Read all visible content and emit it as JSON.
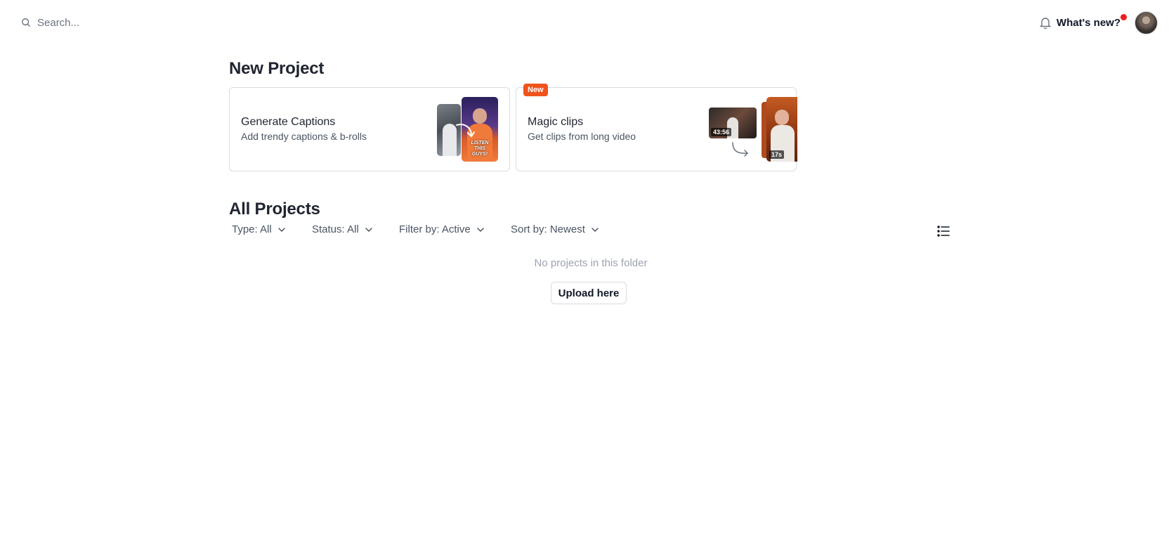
{
  "search": {
    "placeholder": "Search..."
  },
  "header": {
    "whats_new_label": "What's new?",
    "has_notification": true
  },
  "new_project": {
    "heading": "New Project",
    "cards": [
      {
        "title": "Generate Captions",
        "subtitle": "Add trendy captions & b-rolls",
        "thumbnail_caption": "LISTEN THIS GUYS!"
      },
      {
        "badge": "New",
        "title": "Magic clips",
        "subtitle": "Get clips from long video",
        "source_duration": "43:56",
        "clip_duration": "17s"
      }
    ]
  },
  "all_projects": {
    "heading": "All Projects",
    "filters": {
      "type": "Type: All",
      "status": "Status: All",
      "filter_by": "Filter by: Active",
      "sort_by": "Sort by: Newest"
    },
    "empty_message": "No projects in this folder",
    "upload_label": "Upload here"
  },
  "colors": {
    "accent": "#f0531c",
    "notification_dot": "#ef1c1c",
    "text_primary": "#1f2430",
    "text_muted": "#9ca3af"
  }
}
